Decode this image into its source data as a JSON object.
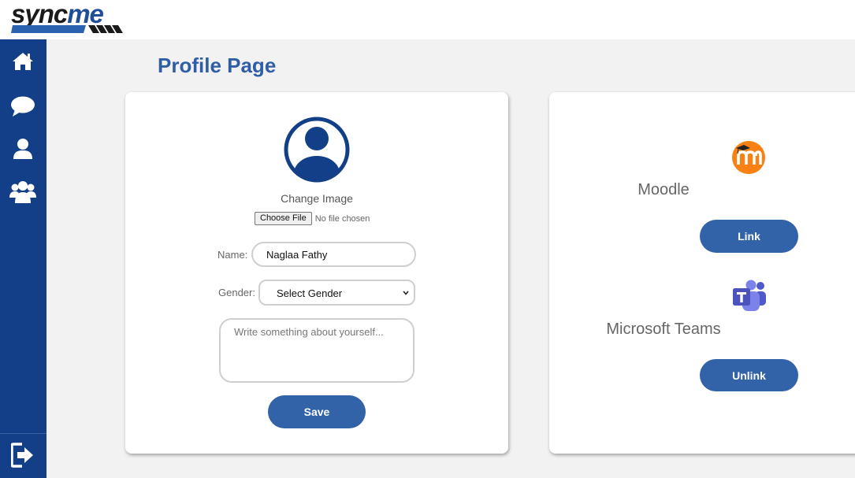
{
  "app": {
    "logo": {
      "part1": "sync",
      "part2": "me"
    }
  },
  "sidebar": {
    "items": [
      {
        "icon": "home-icon"
      },
      {
        "icon": "chat-icon"
      },
      {
        "icon": "user-icon"
      },
      {
        "icon": "group-icon"
      }
    ],
    "logout_icon": "logout-icon"
  },
  "page": {
    "title": "Profile Page"
  },
  "profile": {
    "change_image_label": "Change Image",
    "file_button_label": "Choose File",
    "file_status": "No file chosen",
    "name_label": "Name:",
    "name_value": "Naglaa Fathy",
    "gender_label": "Gender:",
    "gender_selected": "Select Gender",
    "about_placeholder": "Write something about yourself...",
    "save_label": "Save"
  },
  "integrations": [
    {
      "name": "Moodle",
      "button_label": "Link",
      "icon": "moodle-icon",
      "brand_color": "#f98012"
    },
    {
      "name": "Microsoft Teams",
      "button_label": "Unlink",
      "icon": "teams-icon",
      "brand_color": "#5059c9"
    }
  ],
  "colors": {
    "sidebar": "#123f88",
    "accent": "#3262a8",
    "title": "#2f5ea6",
    "background": "#f2f2f2"
  }
}
